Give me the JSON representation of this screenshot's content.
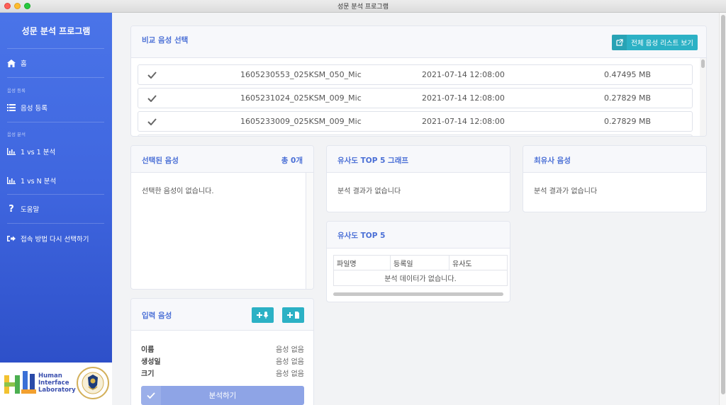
{
  "window": {
    "title": "성문 분석 프로그램"
  },
  "sidebar": {
    "brand": "성문 분석 프로그램",
    "home": "홈",
    "section_register": "음성 등록",
    "register": "음성 등록",
    "section_analysis": "음성 분석",
    "one_vs_one": "1 vs 1 분석",
    "one_vs_n": "1 vs N 분석",
    "help": "도움말",
    "reconnect": "접속 방법 다시 선택하기"
  },
  "logos": {
    "lab_line1": "Human",
    "lab_line2": "Interface",
    "lab_line3": "Laboratory"
  },
  "compare": {
    "title": "비교 음성 선택",
    "view_all": "전체 음성 리스트 보기",
    "rows": [
      {
        "name": "1605230553_025KSM_050_Mic",
        "date": "2021-07-14 12:08:00",
        "size": "0.47495 MB"
      },
      {
        "name": "1605231024_025KSM_009_Mic",
        "date": "2021-07-14 12:08:00",
        "size": "0.27829 MB"
      },
      {
        "name": "1605233009_025KSM_009_Mic",
        "date": "2021-07-14 12:08:00",
        "size": "0.27829 MB"
      }
    ]
  },
  "selected": {
    "title": "선택된 음성",
    "count": "총 0개",
    "empty": "선택한 음성이 없습니다."
  },
  "graph": {
    "title": "유사도 TOP 5 그래프",
    "empty": "분석 결과가 없습니다"
  },
  "most_similar": {
    "title": "최유사 음성",
    "empty": "분석 결과가 없습니다"
  },
  "top5": {
    "title": "유사도 TOP 5",
    "columns": [
      "파일명",
      "등록일",
      "유사도"
    ],
    "empty": "분석 데이터가 없습니다."
  },
  "input": {
    "title": "입력 음성",
    "name_label": "이름",
    "name_value": "음성 없음",
    "created_label": "생성일",
    "created_value": "음성 없음",
    "size_label": "크기",
    "size_value": "음성 없음",
    "analyze": "분석하기"
  }
}
